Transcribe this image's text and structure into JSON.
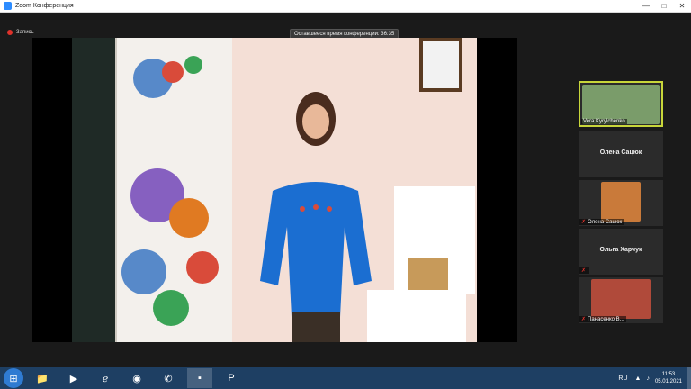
{
  "window": {
    "title": "Zoom Конференция"
  },
  "recording": {
    "label": "Запись",
    "color": "#e0322b"
  },
  "meeting": {
    "time_remaining": "Оставшееся время конференции: 36:35"
  },
  "participants": [
    {
      "name": "Vera Kyrylchenko",
      "video": true,
      "active": true
    },
    {
      "name": "Олена Сацюк",
      "video": false,
      "muted": false
    },
    {
      "name": "Олена Сацюк",
      "video": true,
      "muted": true
    },
    {
      "name": "Ольга Харчук",
      "video": false,
      "muted": true
    },
    {
      "name": "Панасенко В...",
      "video": true,
      "muted": true
    }
  ],
  "taskbar": {
    "apps": [
      "start-icon",
      "explorer-icon",
      "media-player-icon",
      "internet-explorer-icon",
      "chrome-icon",
      "viber-icon",
      "zoom-icon",
      "powerpoint-icon"
    ],
    "lang": "RU",
    "time": "11:53",
    "date": "05.01.2021"
  },
  "colors": {
    "active_speaker_border": "#c8d63a",
    "taskbar": "#1e3f63"
  }
}
